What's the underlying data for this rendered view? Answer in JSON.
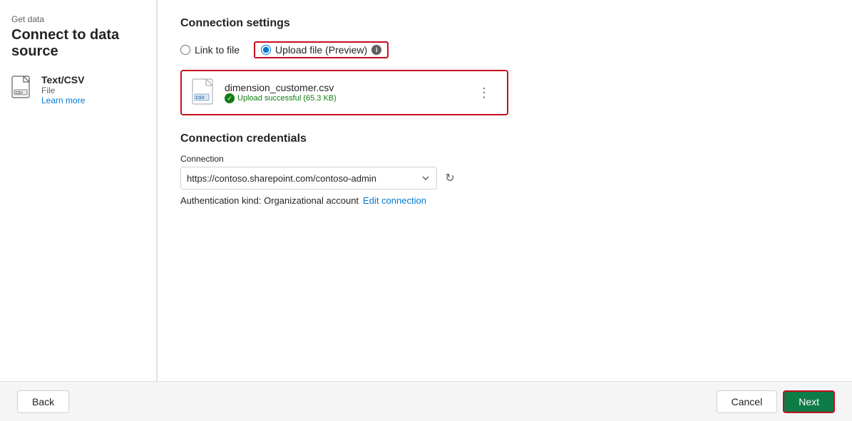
{
  "breadcrumb": "Get data",
  "page_title": "Connect to data source",
  "sidebar": {
    "source_name": "Text/CSV",
    "source_type": "File",
    "learn_more_label": "Learn more"
  },
  "connection_settings": {
    "section_title": "Connection settings",
    "link_to_file_label": "Link to file",
    "upload_file_label": "Upload file (Preview)",
    "upload_file_selected": true,
    "file": {
      "name": "dimension_customer.csv",
      "status": "Upload successful (65.3 KB)"
    }
  },
  "connection_credentials": {
    "section_title": "Connection credentials",
    "connection_label": "Connection",
    "connection_value": "https://contoso.sharepoint.com/contoso-admin",
    "auth_kind_prefix": "Authentication kind: Organizational account",
    "edit_connection_label": "Edit connection"
  },
  "footer": {
    "back_label": "Back",
    "cancel_label": "Cancel",
    "next_label": "Next"
  }
}
